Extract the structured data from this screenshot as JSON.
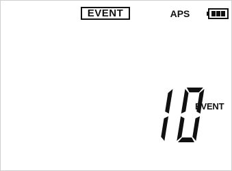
{
  "status_bar": {
    "mode_label": "EVENT",
    "aps_label": "APS",
    "battery_icon": "battery-full-icon"
  },
  "display": {
    "reading_value": "10",
    "unit_label": "EVENT"
  },
  "colors": {
    "background": "#ffffff",
    "ink": "#111111"
  }
}
